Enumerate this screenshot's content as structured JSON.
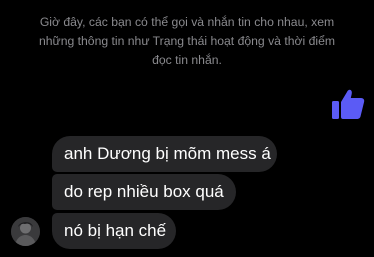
{
  "notice": {
    "line1": "Giờ đây, các bạn có thể gọi và nhắn tin cho nhau, xem",
    "line2": "những thông tin như Trạng thái hoạt động và thời điểm",
    "line3": "đọc tin nhắn."
  },
  "sent": {
    "icon": "thumbs-up-icon",
    "color": "#5b5bf5"
  },
  "messages": [
    {
      "text": "anh Dương bị mõm mess á"
    },
    {
      "text": "do rep nhiều box quá"
    },
    {
      "text": "nó bị hạn chế"
    }
  ],
  "colors": {
    "background": "#000000",
    "bubble": "#262628",
    "notice_text": "#8a8a8e",
    "accent": "#5b5bf5"
  }
}
